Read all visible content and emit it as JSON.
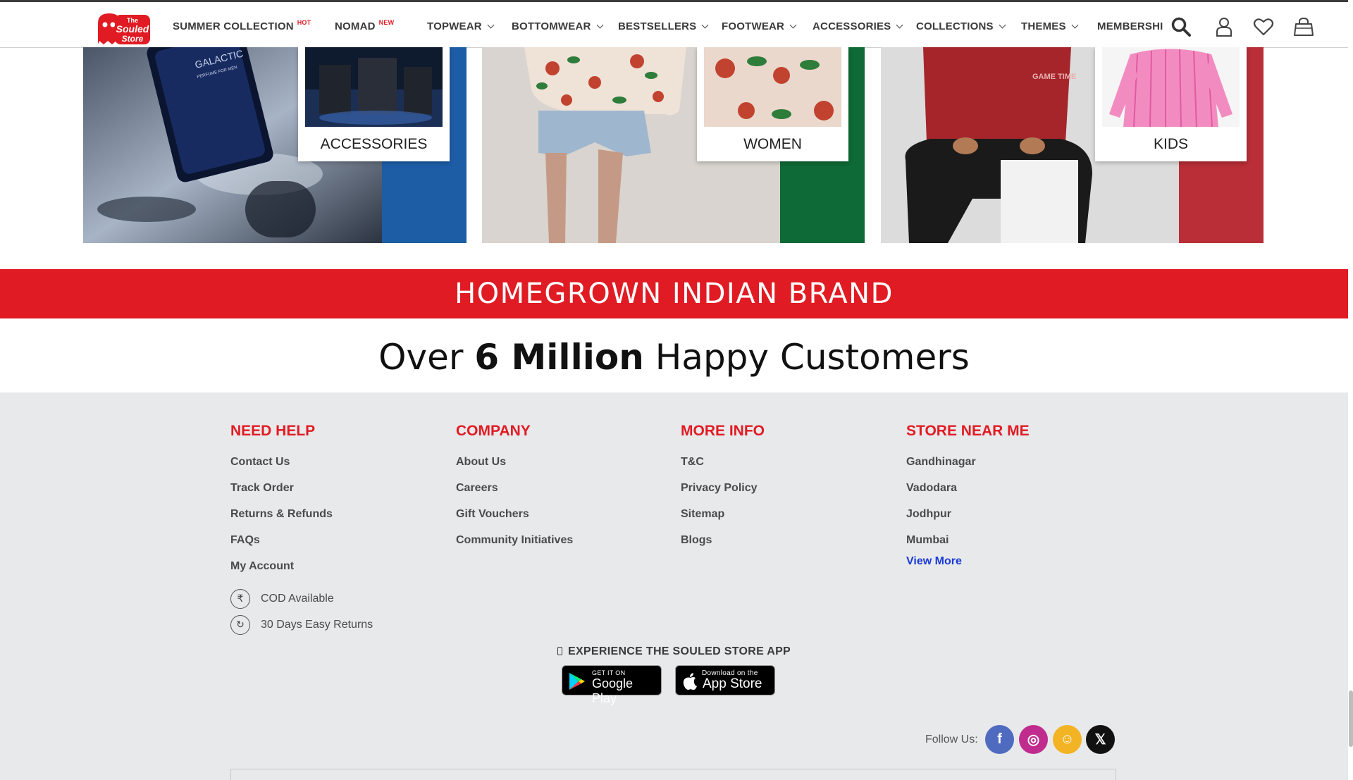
{
  "nav": {
    "items": [
      {
        "label": "SUMMER COLLECTION",
        "badge": "HOT"
      },
      {
        "label": "NOMAD",
        "badge": "NEW"
      },
      {
        "label": "TOPWEAR"
      },
      {
        "label": "BOTTOMWEAR"
      },
      {
        "label": "BESTSELLERS"
      },
      {
        "label": "FOOTWEAR"
      },
      {
        "label": "ACCESSORIES"
      },
      {
        "label": "COLLECTIONS"
      },
      {
        "label": "THEMES"
      },
      {
        "label": "MEMBERSHIP"
      }
    ],
    "logo_text": [
      "The",
      "Souled",
      "Store"
    ],
    "icons": [
      "search-icon",
      "user-icon",
      "heart-icon",
      "bag-icon"
    ]
  },
  "tiles": [
    {
      "label": "ACCESSORIES",
      "strip_color": "#1d5da6",
      "product_text": [
        "GALACTIC",
        "PERFUME FOR MEN"
      ]
    },
    {
      "label": "WOMEN",
      "strip_color": "#0e6a36"
    },
    {
      "label": "KIDS",
      "strip_color": "#b92e37",
      "print_text": "GAME TIME"
    }
  ],
  "banner": {
    "text": "HOMEGROWN INDIAN BRAND"
  },
  "tagline": {
    "prefix": "Over ",
    "strong": "6 Million",
    "suffix": " Happy Customers"
  },
  "footer": {
    "need_help": {
      "title": "NEED HELP",
      "links": [
        "Contact Us",
        "Track Order",
        "Returns & Refunds",
        "FAQs",
        "My Account"
      ],
      "features": [
        {
          "icon": "rupee-icon",
          "glyph": "₹",
          "label": "COD Available"
        },
        {
          "icon": "refresh-icon",
          "glyph": "↻",
          "label": "30 Days Easy Returns"
        }
      ]
    },
    "company": {
      "title": "COMPANY",
      "links": [
        "About Us",
        "Careers",
        "Gift Vouchers",
        "Community Initiatives"
      ]
    },
    "more_info": {
      "title": "MORE INFO",
      "links": [
        "T&C",
        "Privacy Policy",
        "Sitemap",
        "Blogs"
      ]
    },
    "stores": {
      "title": "STORE NEAR ME",
      "links": [
        "Gandhinagar",
        "Vadodara",
        "Jodhpur",
        "Mumbai"
      ],
      "view_more": "View More"
    },
    "app": {
      "heading": "EXPERIENCE THE SOULED STORE APP",
      "google_small": "GET IT ON",
      "google_big": "Google Play",
      "apple_small": "Download on the",
      "apple_big": "App Store"
    },
    "follow_label": "Follow Us:",
    "social": [
      {
        "name": "facebook",
        "glyph": "f",
        "color": "#4e6bbf"
      },
      {
        "name": "instagram",
        "glyph": "◎",
        "color": "#c02c8e"
      },
      {
        "name": "snapchat",
        "glyph": "☺",
        "color": "#f2b324"
      },
      {
        "name": "x",
        "glyph": "𝕏",
        "color": "#111111"
      }
    ]
  }
}
